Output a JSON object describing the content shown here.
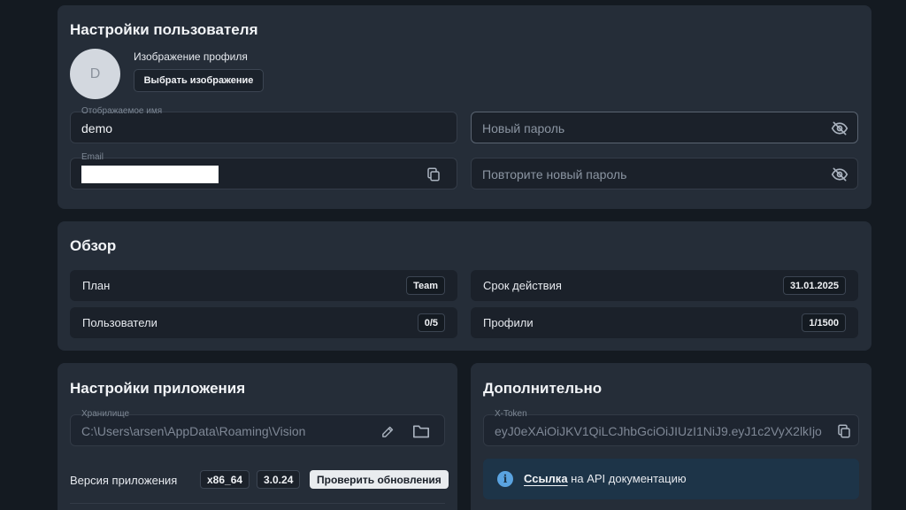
{
  "user_settings": {
    "title": "Настройки пользователя",
    "avatar_letter": "D",
    "profile_image_label": "Изображение профиля",
    "choose_image_button": "Выбрать изображение",
    "display_name": {
      "legend": "Отображаемое имя",
      "value": "demo"
    },
    "new_password": {
      "placeholder": "Новый пароль",
      "icon": "eye-off-icon"
    },
    "email": {
      "legend": "Email",
      "value_redacted": true,
      "icon": "copy-icon"
    },
    "repeat_password": {
      "placeholder": "Повторите новый пароль",
      "icon": "eye-off-icon"
    }
  },
  "overview": {
    "title": "Обзор",
    "rows": [
      {
        "label": "План",
        "value": "Team"
      },
      {
        "label": "Срок действия",
        "value": "31.01.2025"
      },
      {
        "label": "Пользователи",
        "value": "0/5"
      },
      {
        "label": "Профили",
        "value": "1/1500"
      }
    ]
  },
  "app_settings": {
    "title": "Настройки приложения",
    "storage": {
      "legend": "Хранилище",
      "value": "C:\\Users\\arsen\\AppData\\Roaming\\Vision"
    },
    "version_label": "Версия приложения",
    "arch": "x86_64",
    "version": "3.0.24",
    "check_updates_button": "Проверить обновления"
  },
  "extra": {
    "title": "Дополнительно",
    "token": {
      "legend": "X-Token",
      "value": "eyJ0eXAiOiJKV1QiLCJhbGciOiJIUzI1NiJ9.eyJ1c2VyX2lkIjo"
    },
    "info": {
      "link_text": "Ссылка",
      "text": "на API документацию"
    }
  },
  "colors": {
    "background": "#141a21",
    "card": "#252d38",
    "info_box": "#1d3448",
    "info_icon": "#5aa3e0"
  }
}
